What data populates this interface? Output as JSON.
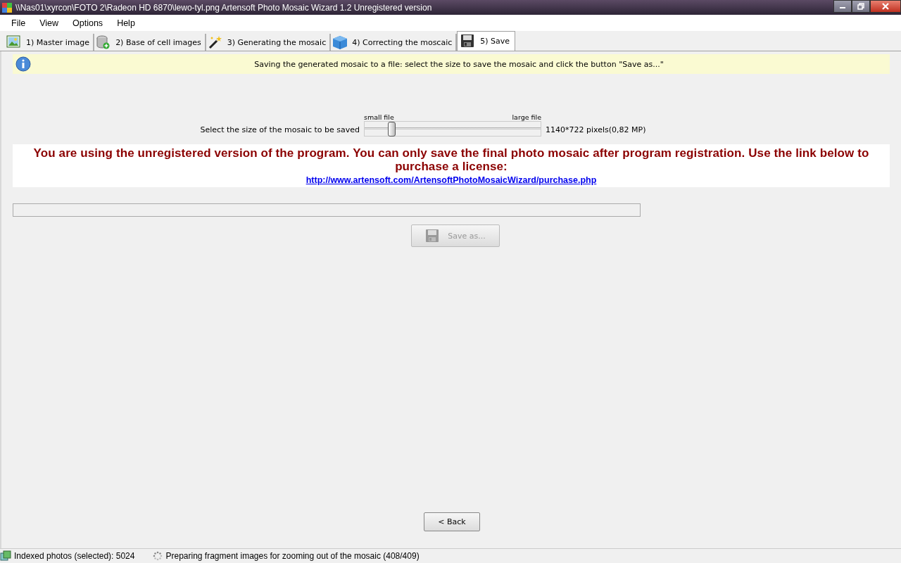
{
  "window": {
    "title": "\\\\Nas01\\xyrcon\\FOTO 2\\Radeon HD 6870\\lewo-tyl.png Artensoft Photo Mosaic Wizard 1.2  Unregistered version"
  },
  "menu": [
    "File",
    "View",
    "Options",
    "Help"
  ],
  "tabs": [
    {
      "label": "1) Master image",
      "selected": false
    },
    {
      "label": "2) Base of cell images",
      "selected": false
    },
    {
      "label": "3) Generating the mosaic",
      "selected": false
    },
    {
      "label": "4) Correcting the moscaic",
      "selected": false
    },
    {
      "label": "5) Save",
      "selected": true
    }
  ],
  "info": "Saving the generated mosaic to a file: select the size to save the mosaic and click the button \"Save as...\"",
  "size_slider": {
    "label": "Select the size of the mosaic to be saved",
    "min_label": "small file",
    "max_label": "large file",
    "level": 0.15,
    "reading": "1140*722 pixels(0,82 MP)"
  },
  "notice": {
    "text": "You are using the unregistered version of the program. You can only save the final photo mosaic after program registration. Use the link below to purchase a license:",
    "link": "http://www.artensoft.com/ArtensoftPhotoMosaicWizard/purchase.php"
  },
  "progress": {
    "level": 0
  },
  "save_button": {
    "label": "Save as...",
    "disabled": true
  },
  "back_button": {
    "label": "< Back"
  },
  "status_bar": {
    "indexed": "Indexed photos (selected): 5024",
    "task": "Preparing fragment images for zooming out of the mosaic (408/409)"
  }
}
